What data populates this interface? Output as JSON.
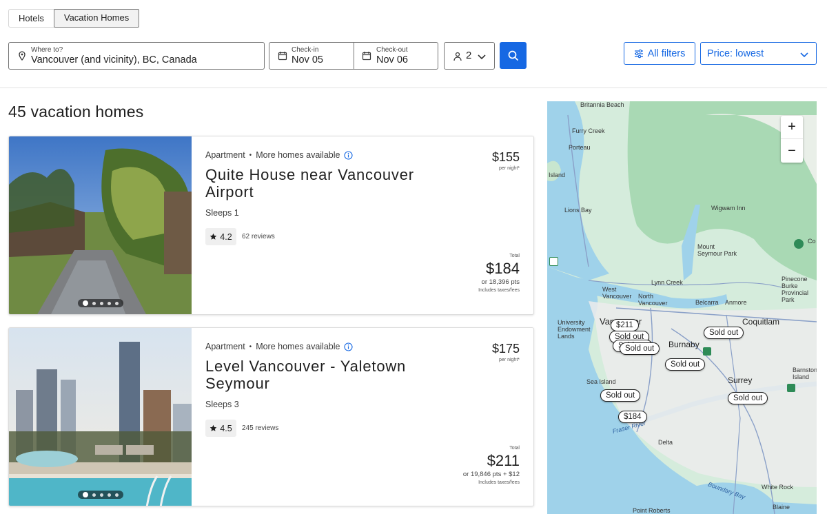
{
  "tabs": [
    {
      "label": "Hotels",
      "active": false
    },
    {
      "label": "Vacation Homes",
      "active": true
    }
  ],
  "search": {
    "where_label": "Where to?",
    "where_value": "Vancouver (and vicinity), BC, Canada",
    "checkin_label": "Check-in",
    "checkin_value": "Nov 05",
    "checkout_label": "Check-out",
    "checkout_value": "Nov 06",
    "guests_value": "2"
  },
  "toolbar": {
    "filters_label": "All filters",
    "sort_label": "Price: lowest"
  },
  "results_title": "45 vacation homes",
  "listings": [
    {
      "type": "Apartment",
      "more": "More homes available",
      "name": "Quite House near Vancouver Airport",
      "sleeps": "Sleeps 1",
      "rating": "4.2",
      "reviews": "62 reviews",
      "price": "$155",
      "per_night": "per night*",
      "total_label": "Total",
      "total": "$184",
      "points": "or 18,396 pts",
      "taxes": "Includes taxes/fees"
    },
    {
      "type": "Apartment",
      "more": "More homes available",
      "name": "Level Vancouver - Yaletown Seymour",
      "sleeps": "Sleeps 3",
      "rating": "4.5",
      "reviews": "245 reviews",
      "price": "$175",
      "per_night": "per night*",
      "total_label": "Total",
      "total": "$211",
      "points": "or 19,846 pts + $12",
      "taxes": "Includes taxes/fees"
    }
  ],
  "map": {
    "labels": {
      "britannia": "Britannia Beach",
      "furry": "Furry Creek",
      "porteau": "Porteau",
      "island": "Island",
      "lions": "Lions Bay",
      "wigwam": "Wigwam Inn",
      "mount_seymour": "Mount Seymour Park",
      "pinecone": "Pinecone Burke Provincial Park",
      "lynn": "Lynn Creek",
      "west_van": "West Vancouver",
      "north_van": "North Vancouver",
      "belcarra": "Belcarra",
      "anmore": "Anmore",
      "university": "University Endowment Lands",
      "vancouver": "Vancouver",
      "coquitlam": "Coquitlam",
      "burnaby": "Burnaby",
      "sea_island": "Sea Island",
      "surrey": "Surrey",
      "barnston": "Barnston Island",
      "fraser": "Fraser River",
      "delta": "Delta",
      "boundary": "Boundary Bay",
      "white_rock": "White Rock",
      "point_roberts": "Point Roberts",
      "blaine": "Blaine",
      "co": "Co"
    },
    "pins": [
      {
        "label": "$211"
      },
      {
        "label": "Sold out"
      },
      {
        "label": "Sold out"
      },
      {
        "label": "Sold out"
      },
      {
        "label": "Sold out"
      },
      {
        "label": "Sold out"
      },
      {
        "label": "Sold out"
      },
      {
        "label": "Sold out"
      },
      {
        "label": "$184"
      }
    ],
    "zoom_in": "+",
    "zoom_out": "−"
  },
  "colors": {
    "accent": "#1668e3",
    "map_land": "#cfe8d8",
    "map_water": "#9fd2ea",
    "map_mountain": "#a9d9b4"
  }
}
